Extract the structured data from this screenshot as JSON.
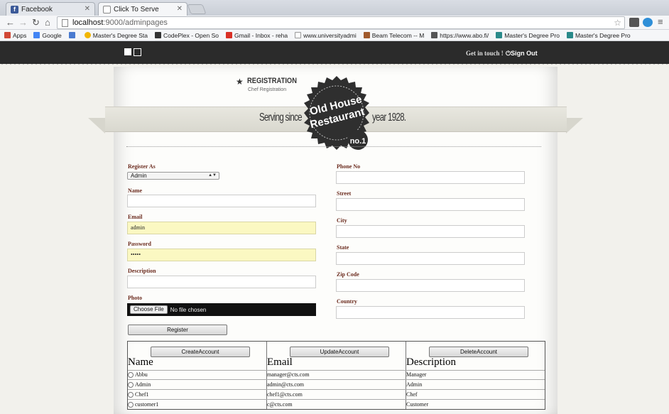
{
  "browser": {
    "tabs": [
      {
        "title": "Facebook",
        "icon": "facebook-icon",
        "active": false
      },
      {
        "title": "Click To Serve",
        "icon": "page-icon",
        "active": true
      }
    ],
    "address": {
      "host": "localhost",
      "path": ":9000/adminpages"
    },
    "bookmarks": [
      {
        "label": "Apps",
        "icon": "apps-icon",
        "color": "#d14836"
      },
      {
        "label": "Google",
        "icon": "google-icon",
        "color": "#4285f4"
      },
      {
        "label": "",
        "icon": "google-plus-icon",
        "color": "#4a7bd0"
      },
      {
        "label": "Master's Degree Sta",
        "icon": "heart-icon",
        "color": "#f2b600"
      },
      {
        "label": "CodePlex - Open So",
        "icon": "codeplex-icon",
        "color": "#333333"
      },
      {
        "label": "Gmail - Inbox - reha",
        "icon": "gmail-icon",
        "color": "#d93025"
      },
      {
        "label": "www.universityadmi",
        "icon": "page-icon",
        "color": "#bbbbbb"
      },
      {
        "label": "Beam Telecom -- M",
        "icon": "beam-icon",
        "color": "#a05a2c"
      },
      {
        "label": "https://www.abo.fi/",
        "icon": "abo-icon",
        "color": "#555555"
      },
      {
        "label": "Master's Degree Pro",
        "icon": "swirl-icon",
        "color": "#2a8a8a"
      },
      {
        "label": "Master's Degree Pro",
        "icon": "swirl-icon",
        "color": "#2a8a8a"
      }
    ]
  },
  "header": {
    "get_in_touch": "Get in touch !",
    "sign_out": "Sign Out"
  },
  "branding": {
    "registration_title": "REGISTRATION",
    "registration_subtitle": "Chef Registration",
    "serving_since": "Serving since",
    "year": "year 1928.",
    "badge_line1": "Old House",
    "badge_line2": "Restaurant",
    "badge_no": "no.1"
  },
  "form": {
    "register_as": {
      "label": "Register As",
      "value": "Admin"
    },
    "name": {
      "label": "Name",
      "value": ""
    },
    "email": {
      "label": "Email",
      "value": "admin"
    },
    "password": {
      "label": "Password",
      "value": "•••••"
    },
    "description": {
      "label": "Description",
      "value": ""
    },
    "photo": {
      "label": "Photo",
      "button": "Choose File",
      "status": "No file chosen"
    },
    "phone": {
      "label": "Phone No",
      "value": ""
    },
    "street": {
      "label": "Street",
      "value": ""
    },
    "city": {
      "label": "City",
      "value": ""
    },
    "state": {
      "label": "State",
      "value": ""
    },
    "zip": {
      "label": "Zip Code",
      "value": ""
    },
    "country": {
      "label": "Country",
      "value": ""
    },
    "register_button": "Register"
  },
  "accounts": {
    "create_button": "CreateAccount",
    "update_button": "UpdateAccount",
    "delete_button": "DeleteAccount",
    "columns": [
      "Name",
      "Email",
      "Description"
    ],
    "rows": [
      {
        "name": "Abbu",
        "email": "manager@cts.com",
        "description": "Manager"
      },
      {
        "name": "Admin",
        "email": "admin@cts.com",
        "description": "Admin"
      },
      {
        "name": "Chef1",
        "email": "chef1@cts.com",
        "description": "Chef"
      },
      {
        "name": "customer1",
        "email": "c@cts.com",
        "description": "Customer"
      }
    ]
  }
}
